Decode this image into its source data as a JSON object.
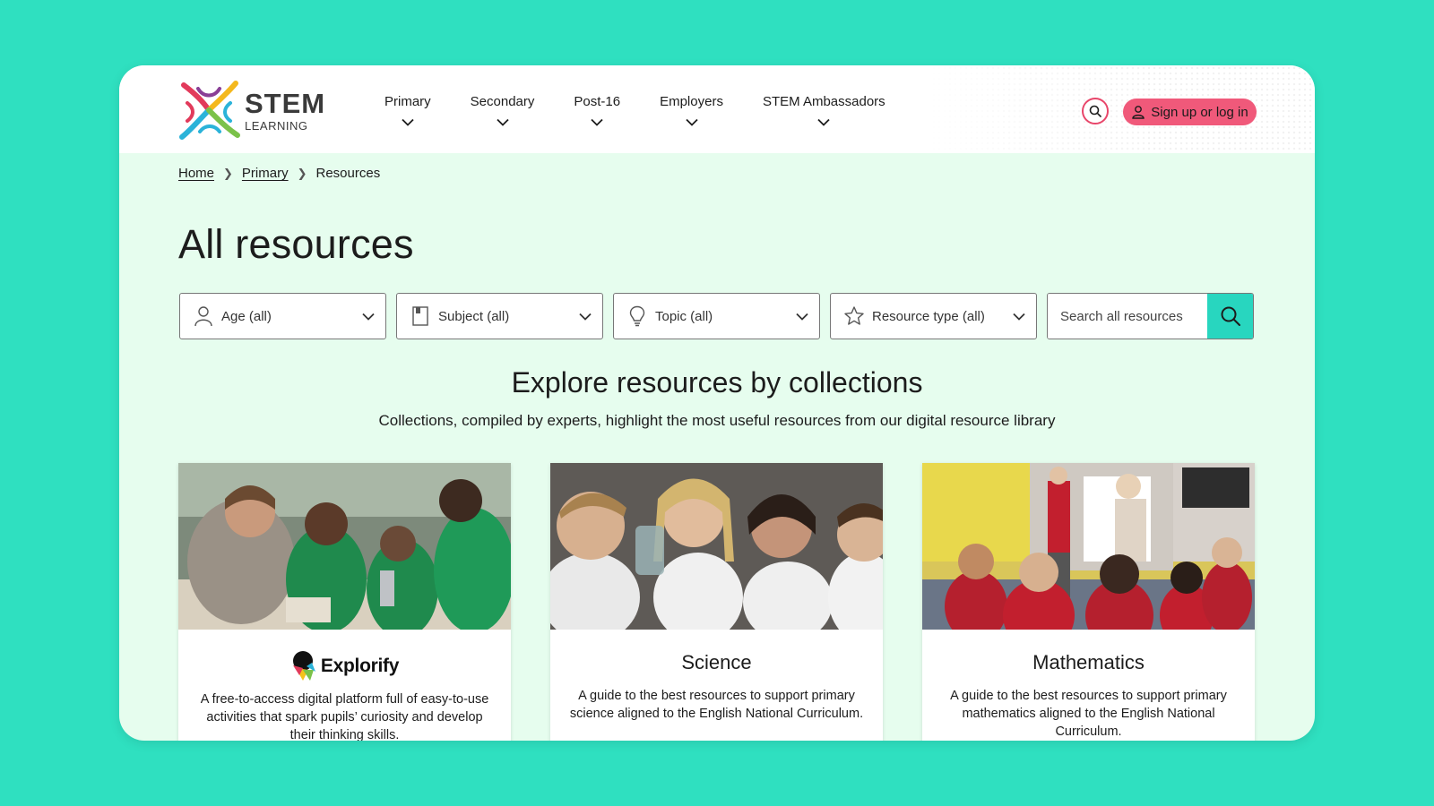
{
  "brand": {
    "name": "STEM",
    "subname": "LEARNING",
    "colors": {
      "background": "#2fe0c0",
      "page": "#e6fdee",
      "accent_pink": "#f0597a",
      "accent_teal": "#28d6bf"
    }
  },
  "nav": {
    "items": [
      {
        "label": "Primary",
        "icon": "chevron-down-icon"
      },
      {
        "label": "Secondary",
        "icon": "chevron-down-icon"
      },
      {
        "label": "Post-16",
        "icon": "chevron-down-icon"
      },
      {
        "label": "Employers",
        "icon": "chevron-down-icon"
      },
      {
        "label": "STEM Ambassadors",
        "icon": "chevron-down-icon"
      }
    ],
    "search_icon": "search-icon",
    "signup_label": "Sign up or log in",
    "signup_icon": "user-icon"
  },
  "breadcrumb": {
    "home": "Home",
    "primary": "Primary",
    "current": "Resources"
  },
  "page": {
    "title": "All resources"
  },
  "filters": {
    "age": {
      "label": "Age (all)",
      "icon": "person-icon"
    },
    "subject": {
      "label": "Subject (all)",
      "icon": "book-icon"
    },
    "topic": {
      "label": "Topic (all)",
      "icon": "lightbulb-icon"
    },
    "resource_type": {
      "label": "Resource type (all)",
      "icon": "star-icon"
    },
    "search_placeholder": "Search all resources"
  },
  "explore": {
    "title": "Explore resources by collections",
    "subtitle": "Collections, compiled by experts, highlight the most useful resources from our digital resource library"
  },
  "cards": [
    {
      "title": "Explorify",
      "description": "A free-to-access digital platform full of easy-to-use activities that spark pupils’ curiosity and develop their thinking skills."
    },
    {
      "title": "Science",
      "description": "A guide to the best resources to support primary science aligned to the English National Curriculum."
    },
    {
      "title": "Mathematics",
      "description": "A guide to the best resources to support primary mathematics aligned to the English National Curriculum."
    }
  ]
}
